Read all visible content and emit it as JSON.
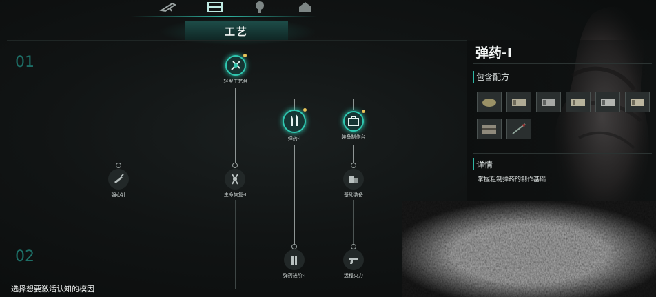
{
  "tabs": [
    {
      "icon": "weapon-icon"
    },
    {
      "icon": "crafting-icon"
    },
    {
      "icon": "tree-icon"
    },
    {
      "icon": "house-icon"
    }
  ],
  "section_title": "工艺",
  "row_numbers": [
    "01",
    "02"
  ],
  "nodes": {
    "workbench": {
      "label": "轻型工艺台",
      "icon": "workbench-icon"
    },
    "ammo1": {
      "label": "弹药-I",
      "icon": "ammo-icon"
    },
    "equip_bench": {
      "label": "装备制作台",
      "icon": "equipment-bench-icon"
    },
    "firm_heart": {
      "label": "强心针",
      "icon": "syringe-icon"
    },
    "life_restore": {
      "label": "生命恢复-I",
      "icon": "medkit-icon"
    },
    "basic_gear": {
      "label": "基础装备",
      "icon": "gear-kit-icon"
    },
    "ammo_adv": {
      "label": "弹药进阶-I",
      "icon": "bullets-icon"
    },
    "ranged_fire": {
      "label": "远程火力",
      "icon": "gun-icon"
    }
  },
  "hint": "选择想要激活认知的模因",
  "detail_panel": {
    "title": "弹药-I",
    "recipes_label": "包含配方",
    "recipe_items": [
      {
        "icon": "gunpowder-icon"
      },
      {
        "icon": "ammo-box-icon"
      },
      {
        "icon": "ammo-box-icon"
      },
      {
        "icon": "ammo-box-icon"
      },
      {
        "icon": "ammo-box-icon"
      },
      {
        "icon": "ammo-box-icon"
      },
      {
        "icon": "ammo-crate-icon"
      },
      {
        "icon": "arrow-icon"
      }
    ],
    "details_label": "详情",
    "description": "掌握粗制弹药的制作基础"
  },
  "colors": {
    "accent": "#2fc7b0",
    "unlock_dot": "#e8c35a",
    "row_number": "#1d6e66"
  }
}
